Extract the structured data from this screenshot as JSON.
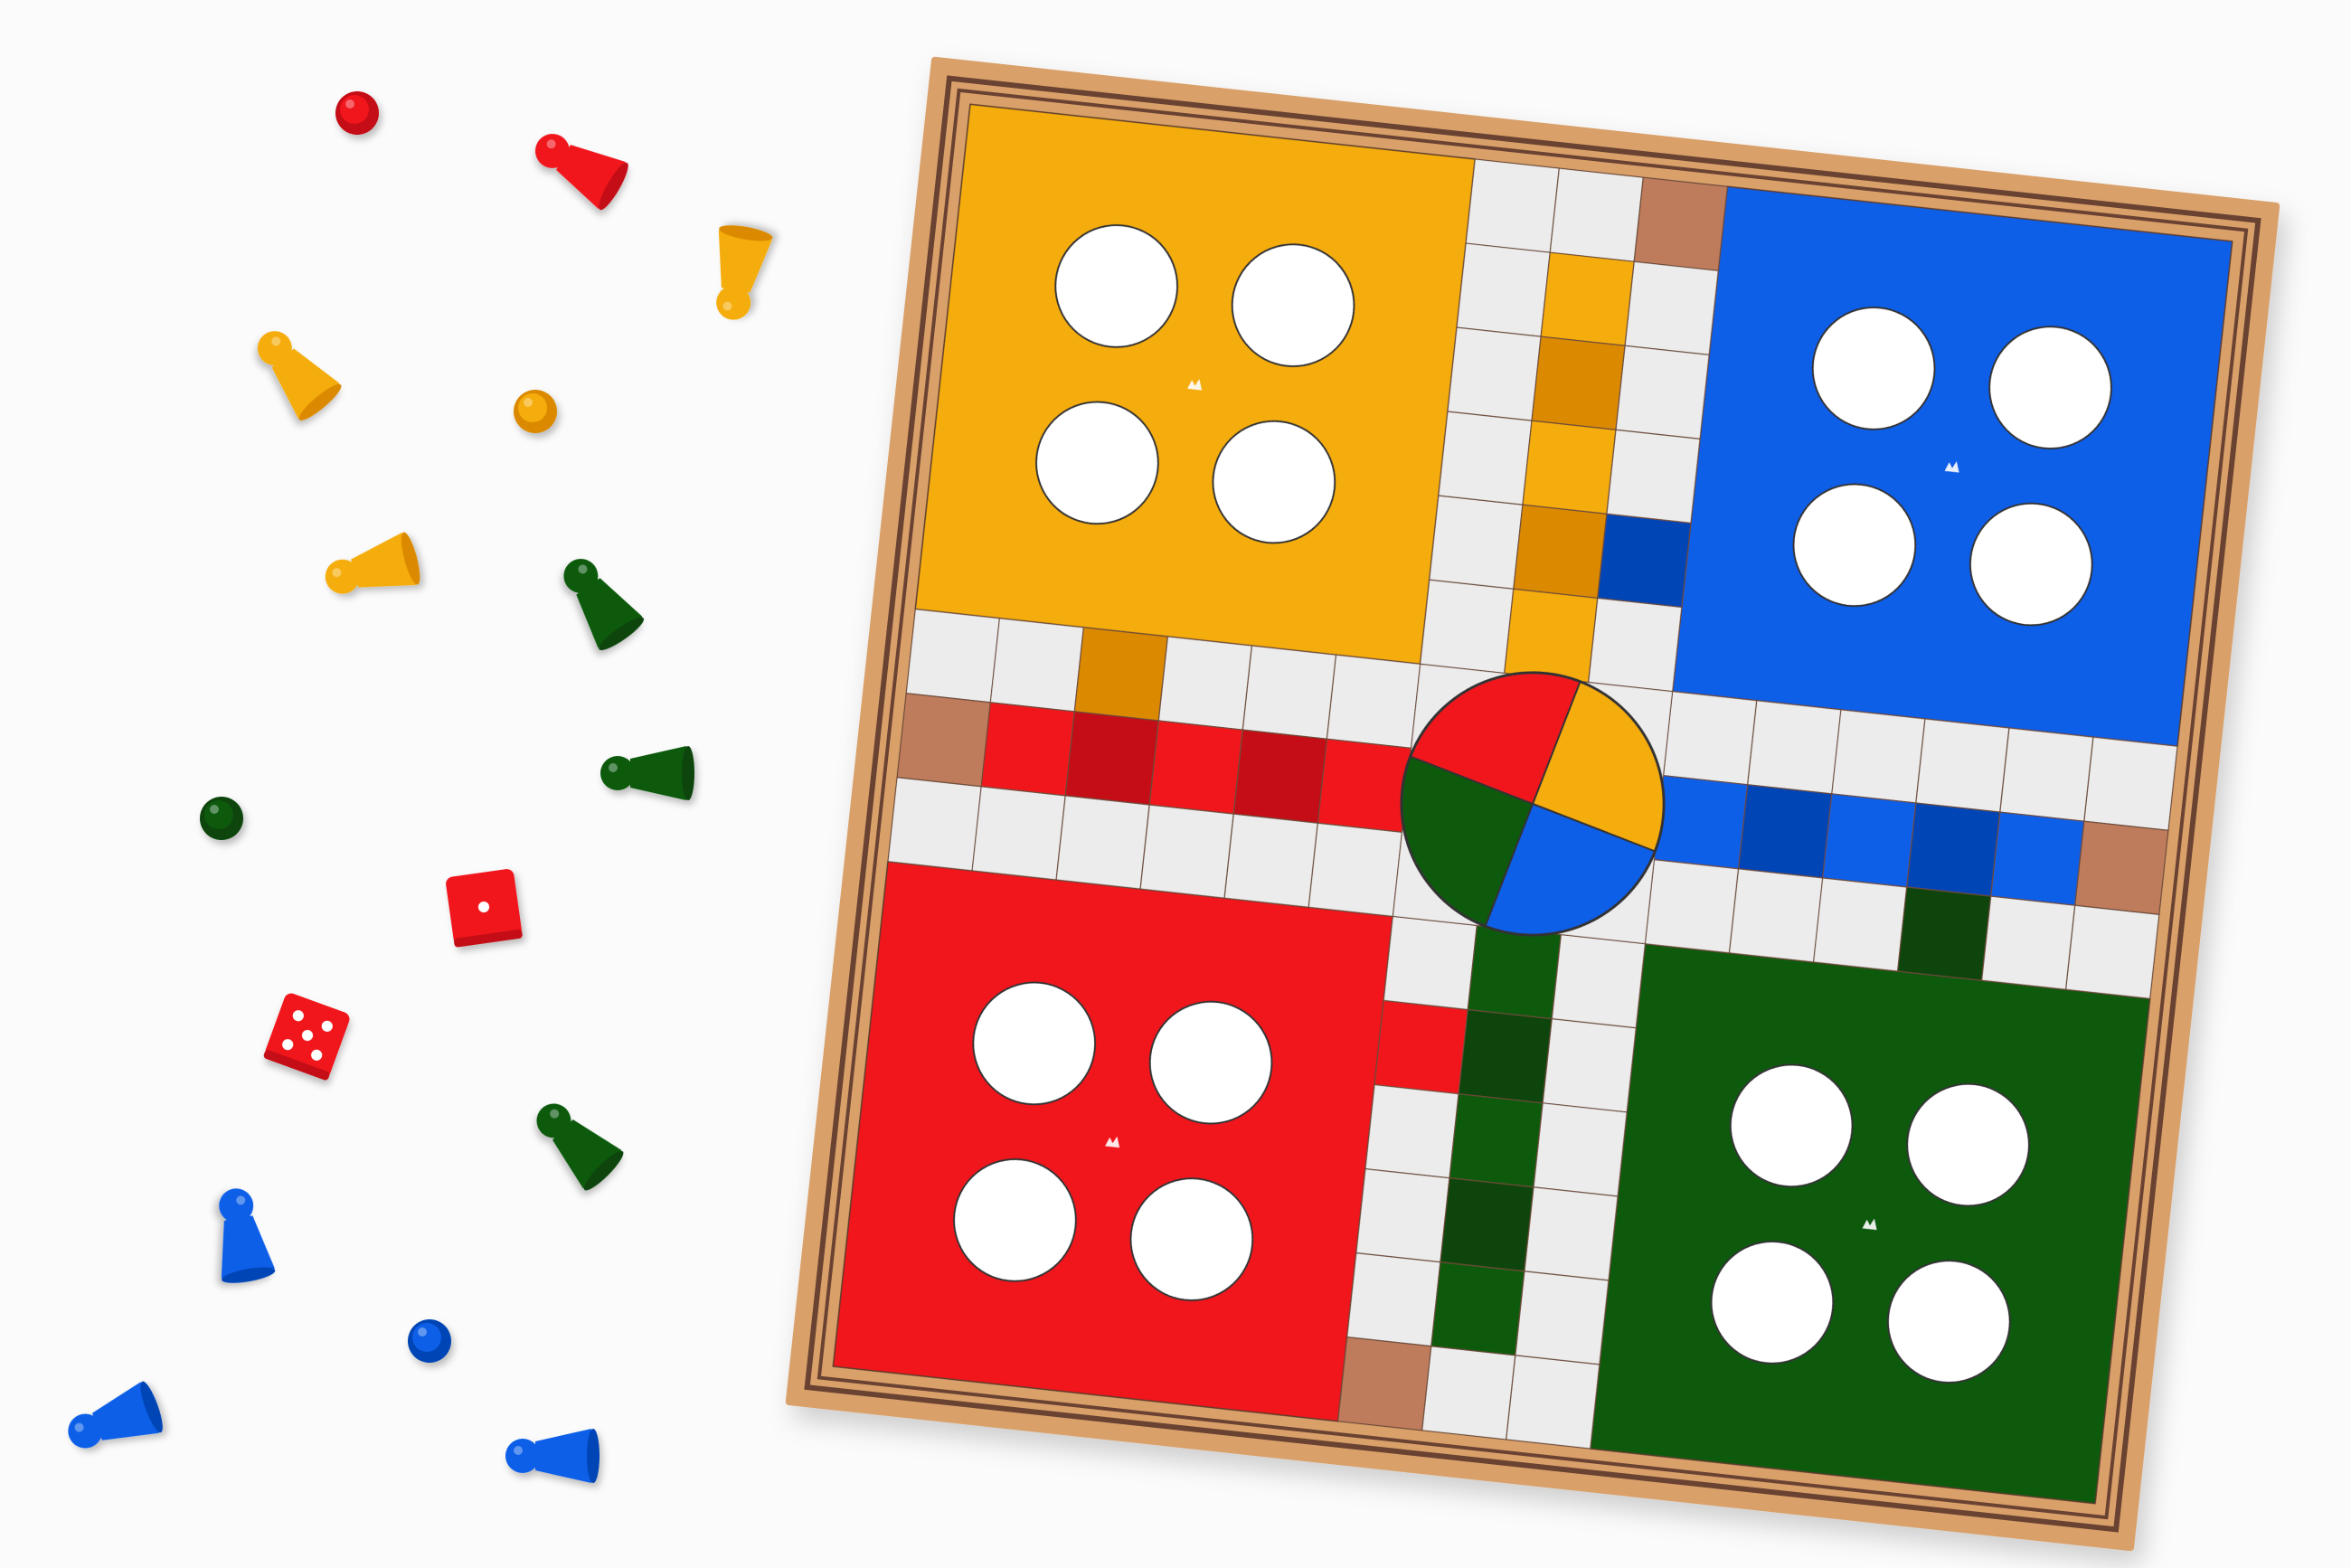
{
  "colors": {
    "background": "#fbfbfb",
    "frame": "#d9a06a",
    "inlay": "#6b4230",
    "track": "#ececec",
    "safe_square": "#bf7c5d",
    "yellow": "#f5ac07",
    "yellow_dark": "#db8a00",
    "blue": "#0a5ee8",
    "blue_dark": "#0644b5",
    "red": "#f0151f",
    "red_dark": "#c40812",
    "green": "#0b5a10",
    "green_dark": "#084409"
  },
  "board": {
    "yards": [
      "yellow",
      "blue",
      "red",
      "green"
    ],
    "home_slots_per_yard": 4,
    "center_wedges": [
      "yellow",
      "blue",
      "green",
      "red"
    ]
  },
  "pieces": [
    {
      "color": "red",
      "shape": "standing-pawn"
    },
    {
      "color": "red",
      "shape": "pawn-on-side"
    },
    {
      "color": "yellow",
      "shape": "pawn-on-side"
    },
    {
      "color": "yellow",
      "shape": "pawn-on-side"
    },
    {
      "color": "yellow",
      "shape": "standing-pawn"
    },
    {
      "color": "yellow",
      "shape": "pawn-on-side"
    },
    {
      "color": "green",
      "shape": "pawn-on-side"
    },
    {
      "color": "green",
      "shape": "pawn-on-side"
    },
    {
      "color": "green",
      "shape": "standing-pawn"
    },
    {
      "color": "green",
      "shape": "pawn-on-side"
    },
    {
      "color": "blue",
      "shape": "pawn-on-side"
    },
    {
      "color": "blue",
      "shape": "standing-pawn"
    },
    {
      "color": "blue",
      "shape": "pawn-on-side"
    },
    {
      "color": "blue",
      "shape": "pawn-on-side"
    }
  ],
  "dice": [
    {
      "color": "red",
      "value": 1
    },
    {
      "color": "red",
      "value": 5
    }
  ]
}
